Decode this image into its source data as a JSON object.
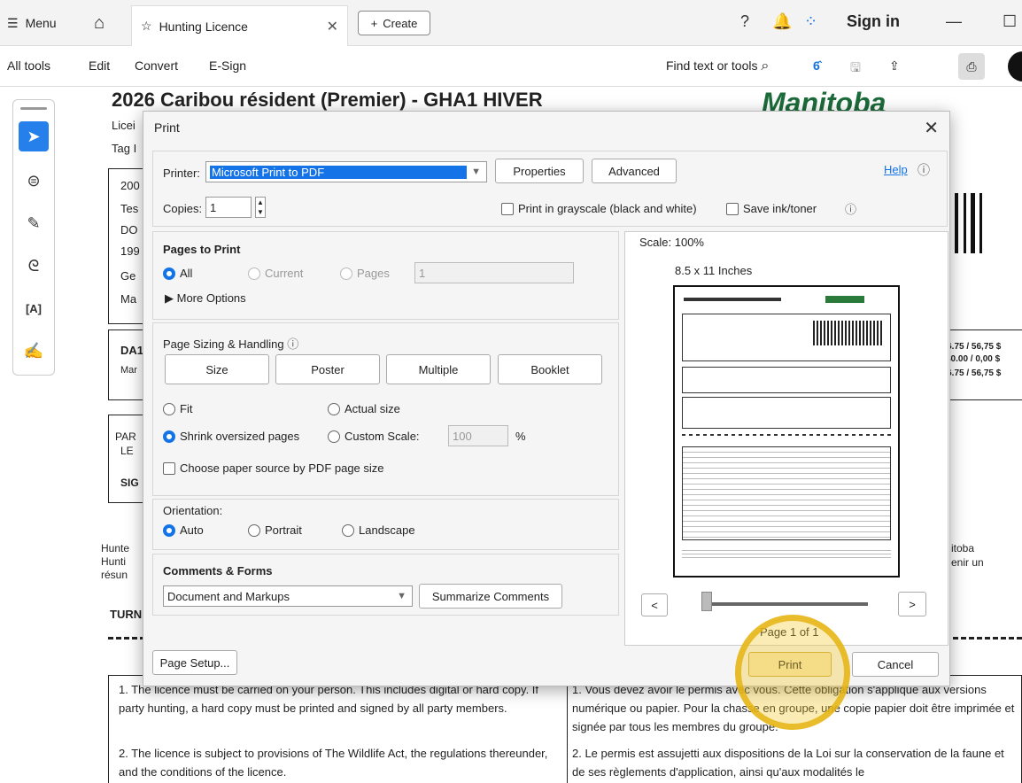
{
  "topbar": {
    "menu": "Menu",
    "tab": "Hunting Licence",
    "create": "Create",
    "signin": "Sign in"
  },
  "toolbar": {
    "all_tools": "All tools",
    "edit": "Edit",
    "convert": "Convert",
    "esign": "E-Sign",
    "find": "Find text or tools"
  },
  "doc": {
    "title": "2026 Caribou résident (Premier) - GHA1 HIVER",
    "brand": "Manitoba",
    "lic": "Licei",
    "tag": "Tag I",
    "l1": "200",
    "l2": "Tes",
    "l3": "DO",
    "l4": "199",
    "l5": "Ge",
    "l6": "Ma",
    "dat": "DA1",
    "mar": "Mar",
    "price1": "$56.75 / 56,75 $",
    "price2": "$0.00 / 0,00 $",
    "price3": "$56.75 / 56,75 $",
    "par": "PAR",
    "le": "LE",
    "sig": "SIG",
    "hunt1": "Hunte",
    "hunt2": "Hunti",
    "resum": "résun",
    "right1": "itoba",
    "right2": "enir un",
    "turn": "TURN",
    "notes_en": [
      "1. The licence must be carried on your person. This includes digital or hard copy. If party hunting, a hard copy must be printed and signed by all party members.",
      "2. The licence is subject to provisions of The Wildlife Act, the regulations thereunder, and the conditions of the licence."
    ],
    "notes_fr": [
      "1. Vous devez avoir le permis avec vous. Cette obligation s'applique aux versions numérique ou papier. Pour la chasse en groupe, une copie papier doit être imprimée et signée par tous les membres du groupe.",
      "2. Le permis est assujetti aux dispositions de la Loi sur la conservation de la faune et de ses règlements d'application, ainsi qu'aux modalités le"
    ]
  },
  "dialog": {
    "title": "Print",
    "printer_label": "Printer:",
    "printer_value": "Microsoft Print to PDF",
    "properties": "Properties",
    "advanced": "Advanced",
    "help": "Help",
    "copies_label": "Copies:",
    "copies_value": "1",
    "grayscale": "Print in grayscale (black and white)",
    "save_ink": "Save ink/toner",
    "pages_to_print": "Pages to Print",
    "all": "All",
    "current": "Current",
    "pages": "Pages",
    "pages_value": "1",
    "more_options": "More Options",
    "sizing": "Page Sizing & Handling",
    "size": "Size",
    "poster": "Poster",
    "multiple": "Multiple",
    "booklet": "Booklet",
    "fit": "Fit",
    "actual_size": "Actual size",
    "shrink": "Shrink oversized pages",
    "custom_scale": "Custom Scale:",
    "scale_value": "100",
    "percent": "%",
    "paper_source": "Choose paper source by PDF page size",
    "orientation": "Orientation:",
    "auto": "Auto",
    "portrait": "Portrait",
    "landscape": "Landscape",
    "comments": "Comments & Forms",
    "comments_value": "Document and Markups",
    "summarize": "Summarize Comments",
    "scale": "Scale: 100%",
    "paper_size": "8.5 x 11 Inches",
    "page_of": "Page 1 of 1",
    "page_setup": "Page Setup...",
    "print": "Print",
    "cancel": "Cancel"
  }
}
